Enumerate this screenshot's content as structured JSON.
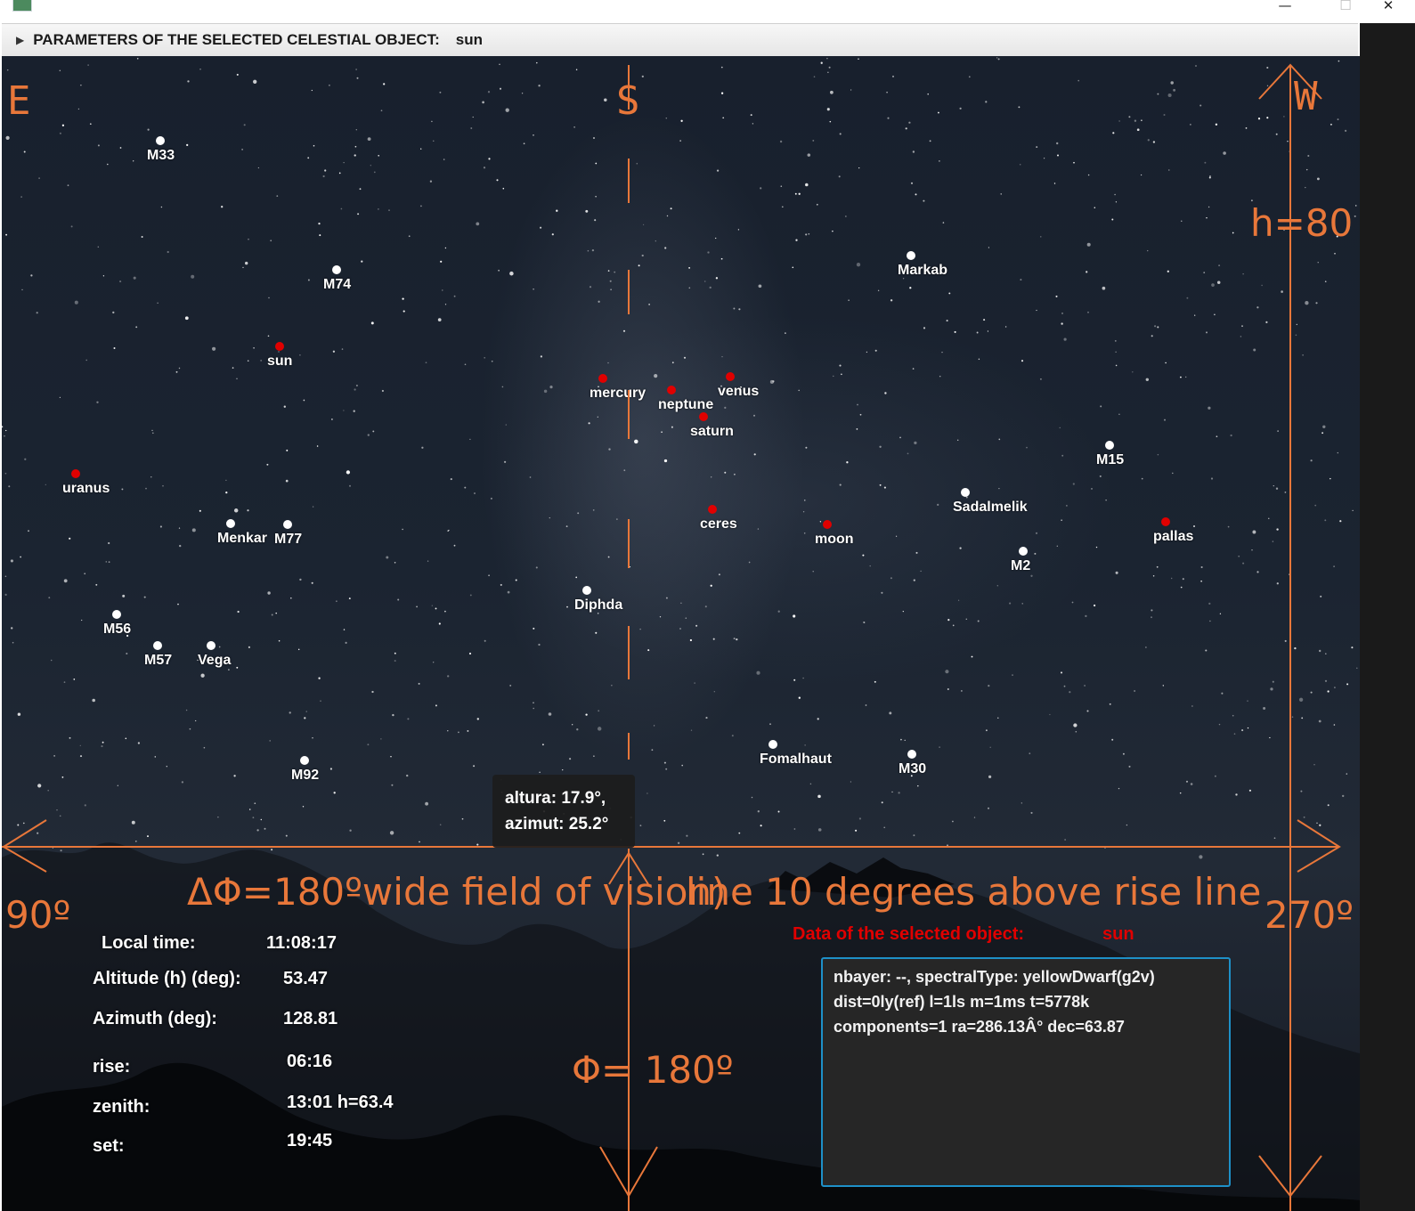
{
  "window": {
    "minimize_icon": "—",
    "maximize_icon": "☐",
    "close_icon": "✕"
  },
  "header": {
    "toggle_icon": "▶",
    "label": "PARAMETERS OF THE SELECTED CELESTIAL OBJECT:",
    "value": "sun"
  },
  "compass": {
    "east": "E",
    "south": "S",
    "west": "W",
    "left_deg": "90º",
    "right_deg": "270º",
    "altitude": "h=80"
  },
  "overlay_text": {
    "field_of_vision": "ΔΦ=180ºwide field of vision)",
    "rise_line": "line  10 degrees above rise line",
    "phi": "Φ=  180º"
  },
  "objects": [
    {
      "name": "M33",
      "kind": "deep-sky",
      "color": "#ffffff"
    },
    {
      "name": "M74",
      "kind": "deep-sky",
      "color": "#ffffff"
    },
    {
      "name": "sun",
      "kind": "star",
      "color": "#e00000"
    },
    {
      "name": "mercury",
      "kind": "planet",
      "color": "#e00000"
    },
    {
      "name": "neptune",
      "kind": "planet",
      "color": "#e00000"
    },
    {
      "name": "venus",
      "kind": "planet",
      "color": "#e00000"
    },
    {
      "name": "saturn",
      "kind": "planet",
      "color": "#e00000"
    },
    {
      "name": "Markab",
      "kind": "star",
      "color": "#ffffff"
    },
    {
      "name": "M15",
      "kind": "deep-sky",
      "color": "#ffffff"
    },
    {
      "name": "uranus",
      "kind": "planet",
      "color": "#e00000"
    },
    {
      "name": "Menkar",
      "kind": "star",
      "color": "#ffffff"
    },
    {
      "name": "M77",
      "kind": "deep-sky",
      "color": "#ffffff"
    },
    {
      "name": "ceres",
      "kind": "dwarf-planet",
      "color": "#e00000"
    },
    {
      "name": "moon",
      "kind": "moon",
      "color": "#e00000"
    },
    {
      "name": "Sadalmelik",
      "kind": "star",
      "color": "#ffffff"
    },
    {
      "name": "pallas",
      "kind": "asteroid",
      "color": "#e00000"
    },
    {
      "name": "M2",
      "kind": "deep-sky",
      "color": "#ffffff"
    },
    {
      "name": "Diphda",
      "kind": "star",
      "color": "#ffffff"
    },
    {
      "name": "M56",
      "kind": "deep-sky",
      "color": "#ffffff"
    },
    {
      "name": "M57",
      "kind": "deep-sky",
      "color": "#ffffff"
    },
    {
      "name": "Vega",
      "kind": "star",
      "color": "#ffffff"
    },
    {
      "name": "M92",
      "kind": "deep-sky",
      "color": "#ffffff"
    },
    {
      "name": "Fomalhaut",
      "kind": "star",
      "color": "#ffffff"
    },
    {
      "name": "M30",
      "kind": "deep-sky",
      "color": "#ffffff"
    }
  ],
  "tooltip": {
    "line1": "altura: 17.9°,",
    "line2": "azimut: 25.2°"
  },
  "info": {
    "local_time_label": "Local time:",
    "local_time": "11:08:17",
    "altitude_label": "Altitude (h) (deg):",
    "altitude": "53.47",
    "azimuth_label": "Azimuth (deg):",
    "azimuth": "128.81",
    "rise_label": "rise:",
    "rise": "06:16",
    "zenith_label": "zenith:",
    "zenith": "13:01 h=63.4",
    "set_label": "set:",
    "set": "19:45"
  },
  "selected": {
    "title": "Data of the selected object:",
    "name": "sun",
    "details": [
      "nbayer: --, spectralType: yellowDwarf(g2v)",
      "dist=0ly(ref) l=1ls m=1ms t=5778k",
      "components=1 ra=286.13Â° dec=63.87"
    ]
  },
  "colors": {
    "accent_orange": "#e8773a",
    "planet_red": "#e00000",
    "box_border": "#1e90c8"
  }
}
